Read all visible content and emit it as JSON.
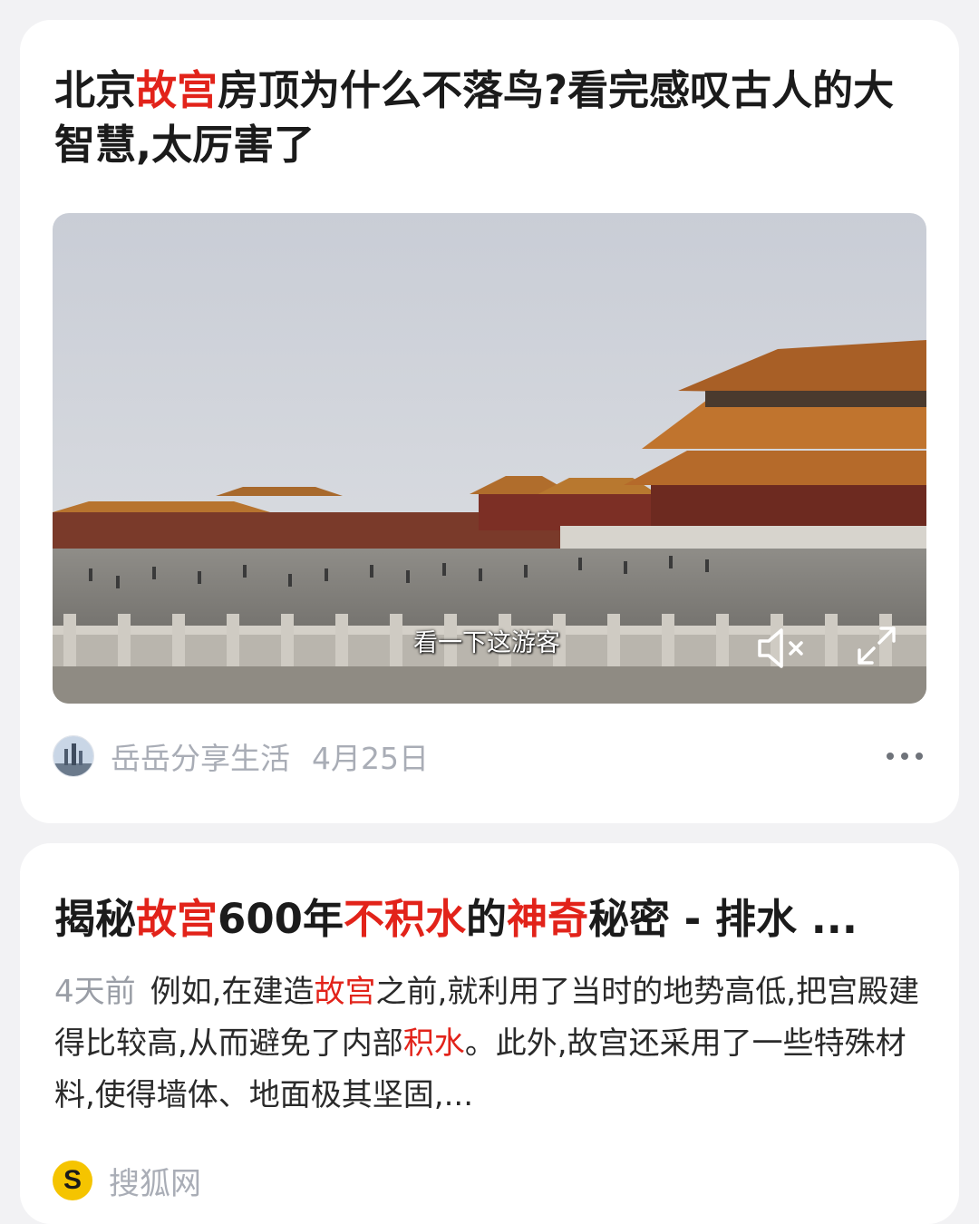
{
  "article1": {
    "title_parts": [
      {
        "text": "北京",
        "hl": false
      },
      {
        "text": "故宫",
        "hl": true
      },
      {
        "text": "房顶为什么不落鸟?看完感叹古人的大智慧,太厉害了",
        "hl": false
      }
    ],
    "video": {
      "subtitle": "看一下这游客",
      "mute_icon": "speaker-muted-icon",
      "fullscreen_icon": "expand-icon"
    },
    "author": "岳岳分享生活",
    "date": "4月25日",
    "more_icon": "more-dots-icon"
  },
  "article2": {
    "title_parts": [
      {
        "text": "揭秘",
        "hl": false
      },
      {
        "text": "故宫",
        "hl": true
      },
      {
        "text": "600年",
        "hl": false
      },
      {
        "text": "不积水",
        "hl": true
      },
      {
        "text": "的",
        "hl": false
      },
      {
        "text": "神奇",
        "hl": true
      },
      {
        "text": "秘密 - 排水 ...",
        "hl": false
      }
    ],
    "time_ago": "4天前",
    "snippet_parts": [
      {
        "text": "例如,在建造",
        "hl": false
      },
      {
        "text": "故宫",
        "hl": true
      },
      {
        "text": "之前,就利用了当时的地势高低,把宫殿建得比较高,从而避免了内部",
        "hl": false
      },
      {
        "text": "积水",
        "hl": true
      },
      {
        "text": "。此外,故宫还采用了一些特殊材料,使得墙体、地面极其坚固,...",
        "hl": false
      }
    ],
    "source": "搜狐网",
    "source_logo_letter": "S"
  },
  "colors": {
    "highlight": "#e2231a",
    "muted_text": "#a9adb6",
    "card_bg": "#ffffff",
    "page_bg": "#f2f2f4"
  }
}
